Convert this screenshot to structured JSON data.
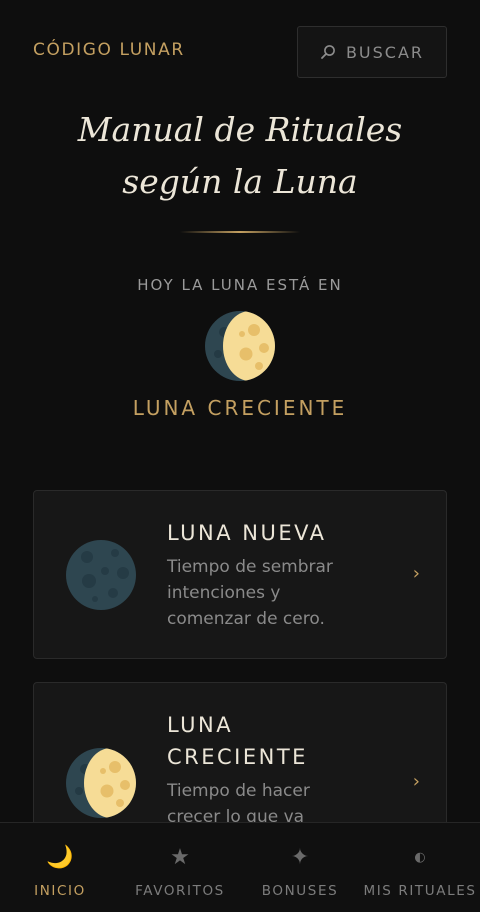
{
  "header": {
    "brand": "CÓDIGO LUNAR",
    "search_label": "BUSCAR",
    "search_icon": "search-icon"
  },
  "hero": {
    "title_line1": "Manual de Rituales",
    "title_line2": "según la Luna",
    "today_label": "HOY LA LUNA ESTÁ EN",
    "today_phase": "LUNA CRECIENTE",
    "today_icon": "waxing-moon-icon"
  },
  "cards": [
    {
      "name": "LUNA NUEVA",
      "desc_line1": "Tiempo de sembrar",
      "desc_line2": "intenciones y",
      "desc_line3": "comenzar de cero.",
      "icon": "new-moon-icon",
      "chevron": "›"
    },
    {
      "name_line1": "LUNA",
      "name_line2": "CRECIENTE",
      "desc_line1": "Tiempo de hacer",
      "desc_line2": "crecer lo que va",
      "icon": "waxing-moon-icon",
      "chevron": "›"
    }
  ],
  "nav": [
    {
      "label": "INICIO",
      "icon": "🌙",
      "active": true
    },
    {
      "label": "FAVORITOS",
      "icon": "★",
      "active": false
    },
    {
      "label": "BONUSES",
      "icon": "✦",
      "active": false
    },
    {
      "label": "MIS RITUALES",
      "icon": "◐",
      "active": false
    }
  ],
  "colors": {
    "accent": "#c4a061",
    "background": "#0e0e0e",
    "card": "#171717",
    "moon_light": "#f6dc96",
    "moon_dark": "#2e4650"
  }
}
